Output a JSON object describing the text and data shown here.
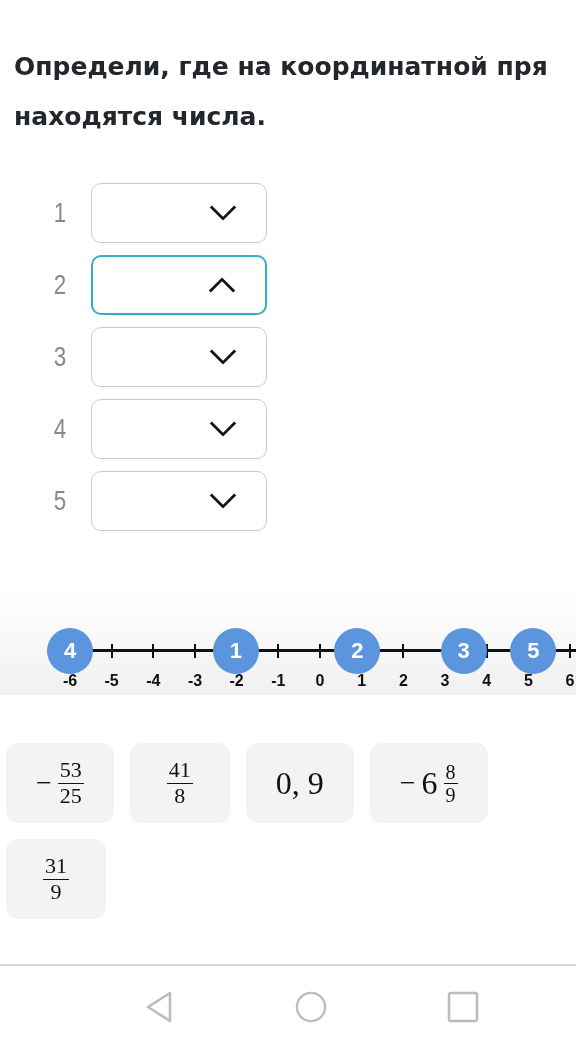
{
  "question": {
    "lines": [
      "Определи, где на координатной пря",
      "находятся числа."
    ]
  },
  "dropdowns": [
    {
      "label": "1",
      "expanded": false
    },
    {
      "label": "2",
      "expanded": true
    },
    {
      "label": "3",
      "expanded": false
    },
    {
      "label": "4",
      "expanded": false
    },
    {
      "label": "5",
      "expanded": false
    }
  ],
  "number_line": {
    "ticks": [
      "-6",
      "-5",
      "-4",
      "-3",
      "-2",
      "-1",
      "0",
      "1",
      "2",
      "3",
      "4",
      "5",
      "6"
    ],
    "markers": [
      {
        "label": "4",
        "level": 0
      },
      {
        "label": "1",
        "level": 0.328
      },
      {
        "label": "2",
        "level": 0.568
      },
      {
        "label": "3",
        "level": 0.778
      },
      {
        "label": "5",
        "level": 0.916
      }
    ]
  },
  "cards": [
    {
      "kind": "fraction",
      "sign": "−",
      "numerator": "53",
      "denominator": "25"
    },
    {
      "kind": "fraction",
      "numerator": "41",
      "denominator": "8"
    },
    {
      "kind": "decimal",
      "text": "0, 9"
    },
    {
      "kind": "mixed",
      "sign": "−",
      "whole": "6",
      "numerator": "8",
      "denominator": "9"
    },
    {
      "kind": "fraction",
      "numerator": "31",
      "denominator": "9"
    }
  ]
}
